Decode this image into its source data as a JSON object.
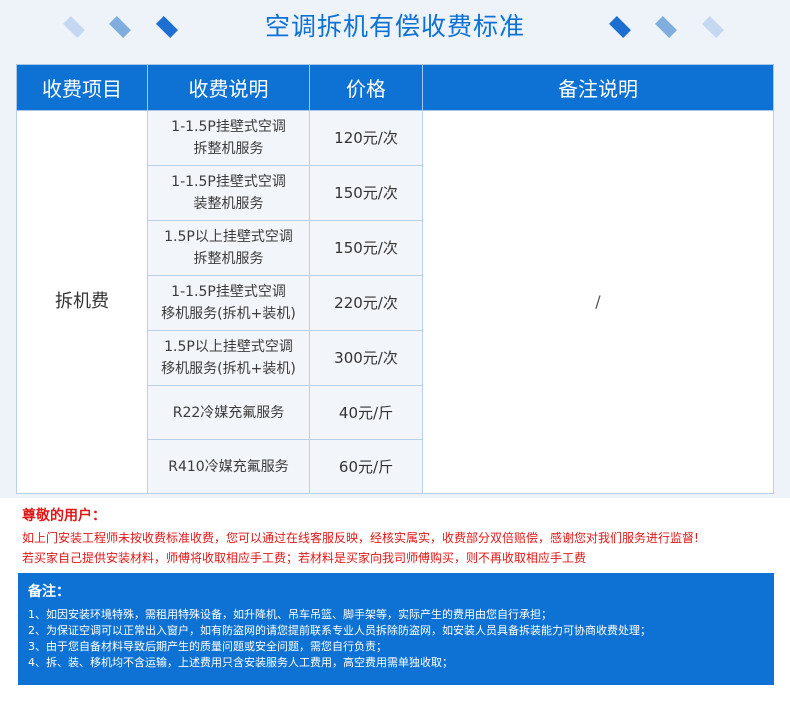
{
  "title": "空调拆机有偿收费标准",
  "colors": {
    "accent": "#0d72d3",
    "warning": "#e01818",
    "background": "#eef3f9"
  },
  "table": {
    "headers": [
      "收费项目",
      "收费说明",
      "价格",
      "备注说明"
    ],
    "category": "拆机费",
    "note": "/",
    "rows": [
      {
        "desc_line1": "1-1.5P挂壁式空调",
        "desc_line2": "拆整机服务",
        "price": "120元/次"
      },
      {
        "desc_line1": "1-1.5P挂壁式空调",
        "desc_line2": "装整机服务",
        "price": "150元/次"
      },
      {
        "desc_line1": "1.5P以上挂壁式空调",
        "desc_line2": "拆整机服务",
        "price": "150元/次"
      },
      {
        "desc_line1": "1-1.5P挂壁式空调",
        "desc_line2": "移机服务(拆机+装机)",
        "price": "220元/次"
      },
      {
        "desc_line1": "1.5P以上挂壁式空调",
        "desc_line2": "移机服务(拆机+装机)",
        "price": "300元/次"
      },
      {
        "desc_line1": "R22冷媒充氟服务",
        "desc_line2": "",
        "price": "40元/斤"
      },
      {
        "desc_line1": "R410冷媒充氟服务",
        "desc_line2": "",
        "price": "60元/斤"
      }
    ]
  },
  "notice": {
    "title": "尊敬的用户：",
    "line1": "如上门安装工程师未按收费标准收费，您可以通过在线客服反映，经核实属实，收费部分双倍赔偿，感谢您对我们服务进行监督!",
    "line2": "若买家自己提供安装材料，师傅将收取相应手工费；若材料是买家向我司师傅购买，则不再收取相应手工费"
  },
  "notes": {
    "title": "备注：",
    "items": [
      "1、如因安装环境特殊，需租用特殊设备，如升降机、吊车吊篮、脚手架等，实际产生的费用由您自行承担；",
      "2、为保证空调可以正常出入窗户，如有防盗网的请您提前联系专业人员拆除防盗网，如安装人员具备拆装能力可协商收费处理；",
      "3、由于您自备材料导致后期产生的质量问题或安全问题，需您自行负责；",
      "4、拆、装、移机均不含运输，上述费用只含安装服务人工费用，高空费用需单独收取；"
    ]
  }
}
